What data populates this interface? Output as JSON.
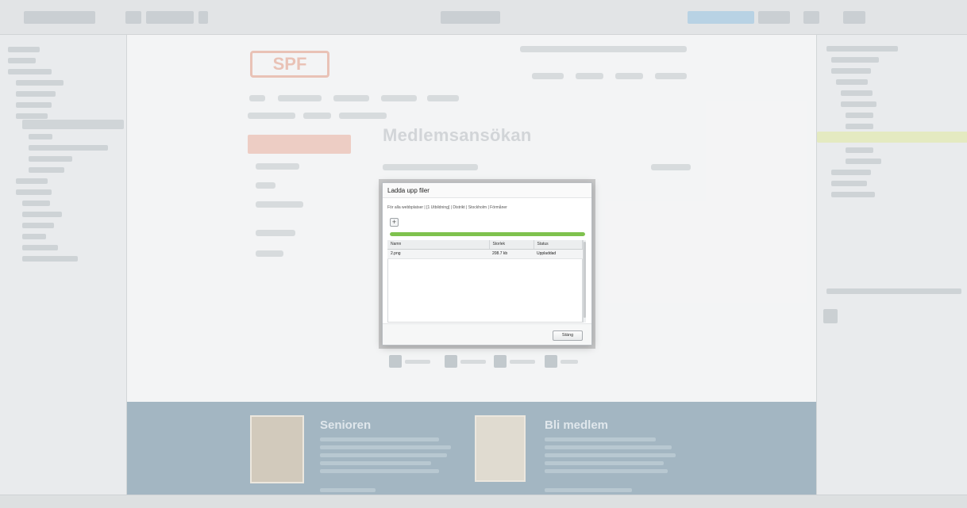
{
  "website": {
    "logo_text": "SPF",
    "page_title": "Medlemsansökan",
    "footer": {
      "left_title": "Senioren",
      "right_title": "Bli medlem"
    }
  },
  "dialog": {
    "title": "Ladda upp filer",
    "path": "För alla webbplatser | [1 Utbildning] | Distrikt | Stockholm | Förmåner",
    "add_icon": "plus-icon",
    "add_label": "+",
    "progress": 1.0,
    "columns": [
      "Namn",
      "Storlek",
      "Status"
    ],
    "files": [
      {
        "name": "2.png",
        "size": "208.7 kb",
        "status": "Uppladdad"
      }
    ],
    "close_label": "Stäng"
  },
  "colors": {
    "progress": "#7fc24e",
    "footer": "#8fa7b5",
    "accent": "#eac2b8"
  }
}
